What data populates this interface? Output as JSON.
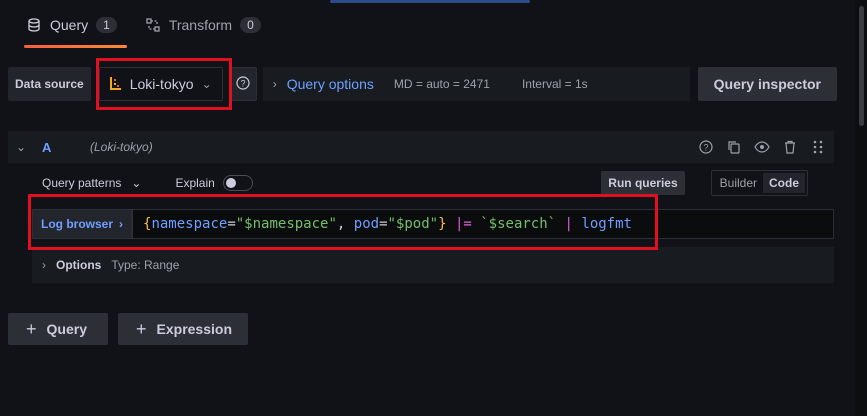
{
  "tabs": [
    {
      "label": "Query",
      "count": "1",
      "icon": "database-icon",
      "active": true
    },
    {
      "label": "Transform",
      "count": "0",
      "icon": "transform-icon",
      "active": false
    }
  ],
  "datasource": {
    "label": "Data source",
    "selected": "Loki-tokyo",
    "query_options_title": "Query options",
    "md": "MD = auto = 2471",
    "interval": "Interval = 1s",
    "inspector_label": "Query inspector"
  },
  "query": {
    "ref_id": "A",
    "ds_name": "(Loki-tokyo)",
    "patterns_label": "Query patterns",
    "explain_label": "Explain",
    "run_label": "Run queries",
    "mode_builder": "Builder",
    "mode_code": "Code",
    "log_browser_label": "Log browser",
    "code_tokens": {
      "open_brace": "{",
      "key1": "namespace",
      "eq1": "=",
      "val1": "\"$namespace\"",
      "comma": ", ",
      "key2": "pod",
      "eq2": "=",
      "val2": "\"$pod\"",
      "close_brace": "}",
      "pipe_filter": " |= ",
      "search": "`$search`",
      "pipe": " | ",
      "fn": "logfmt"
    },
    "options_label": "Options",
    "options_type": "Type: Range"
  },
  "add_buttons": {
    "query_label": "Query",
    "expression_label": "Expression"
  },
  "colors": {
    "accent": "#6e9fff",
    "highlight": "#e01020",
    "tab_underline": "#f55f3e"
  }
}
